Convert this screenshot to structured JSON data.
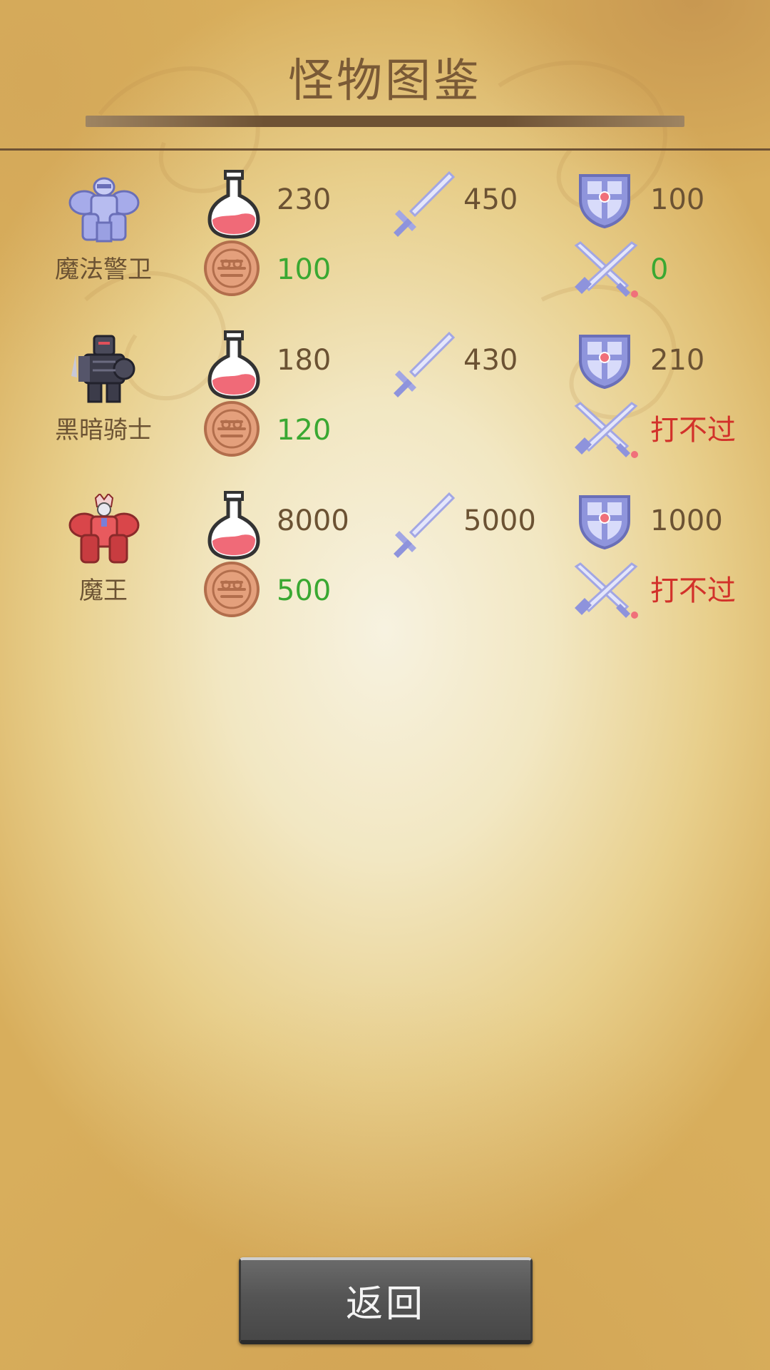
{
  "header": {
    "title": "怪物图鉴"
  },
  "monsters": [
    {
      "name": "魔法警卫",
      "sprite": "magic-guard-sprite",
      "hp": "230",
      "attack": "450",
      "defense": "100",
      "gold": "100",
      "damage": "0",
      "damage_color": "#3aa832"
    },
    {
      "name": "黑暗骑士",
      "sprite": "dark-knight-sprite",
      "hp": "180",
      "attack": "430",
      "defense": "210",
      "gold": "120",
      "damage": "打不过",
      "damage_color": "#d2312a"
    },
    {
      "name": "魔王",
      "sprite": "demon-king-sprite",
      "hp": "8000",
      "attack": "5000",
      "defense": "1000",
      "gold": "500",
      "damage": "打不过",
      "damage_color": "#d2312a"
    }
  ],
  "icons": {
    "hp": "potion-icon",
    "attack": "sword-icon",
    "defense": "shield-icon",
    "gold": "coin-icon",
    "damage": "crossed-swords-icon"
  },
  "colors": {
    "text": "#6b5233",
    "gold_value": "#3aa832",
    "cannot_beat": "#d2312a"
  },
  "footer": {
    "back_label": "返回"
  }
}
